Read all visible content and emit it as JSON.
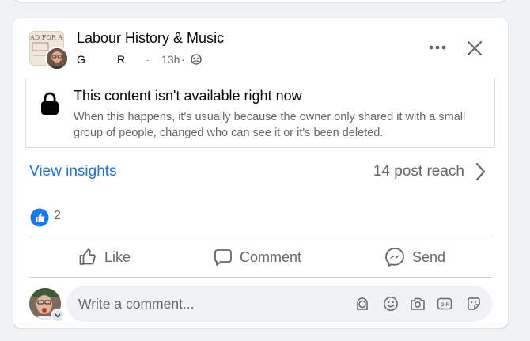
{
  "post": {
    "group_name": "Labour History & Music",
    "group_logo_text": "AD FOR ALL",
    "author_first": "G",
    "author_last": "R",
    "separator": "-",
    "time": "13h",
    "dot": "·",
    "audience_icon": "group-globe-icon",
    "more_label": "•••",
    "close_label": "✕"
  },
  "unavailable": {
    "title": "This content isn't available right now",
    "body": "When this happens, it's usually because the owner only shared it with a small group of people, changed who can see it or it's been deleted."
  },
  "insights": {
    "link": "View insights",
    "reach": "14 post reach"
  },
  "reactions": {
    "count": "2"
  },
  "actions": {
    "like": "Like",
    "comment": "Comment",
    "send": "Send"
  },
  "composer": {
    "placeholder": "Write a comment..."
  },
  "colors": {
    "link_blue": "#216fdb",
    "muted_gray": "#65676b",
    "like_blue": "#1877f2"
  }
}
